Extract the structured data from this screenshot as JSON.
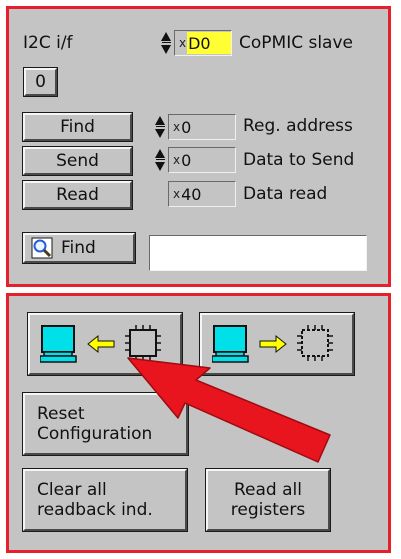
{
  "i2c": {
    "interface_label": "I2C i/f",
    "interface_index": "0",
    "slave_hex_prefix": "x",
    "slave_value": "D0",
    "slave_label": "CoPMIC slave"
  },
  "registers": {
    "find_label": "Find",
    "send_label": "Send",
    "read_label": "Read",
    "reg_address_prefix": "x",
    "reg_address_value": "0",
    "reg_address_label": "Reg. address",
    "data_send_prefix": "x",
    "data_send_value": "0",
    "data_send_label": "Data to Send",
    "data_read_prefix": "x",
    "data_read_value": "40",
    "data_read_label": "Data read"
  },
  "search": {
    "button_label": "Find",
    "value": ""
  },
  "config": {
    "reset_line1": "Reset",
    "reset_line2": "Configuration",
    "clear_line1": "Clear all",
    "clear_line2": "readback ind.",
    "readall_line1": "Read all",
    "readall_line2": "registers"
  },
  "icons": {
    "download": "computer-arrow-left-chip-icon",
    "upload": "computer-arrow-right-chip-icon",
    "annotation": "red-arrow-annotation"
  },
  "colors": {
    "panel_border": "#e4202a",
    "panel_bg": "#c4c4c4",
    "highlight_field": "#ffff33",
    "monitor_screen": "#00e0e8",
    "arrow_yellow": "#ffff00",
    "annotation_red": "#e8141e"
  }
}
